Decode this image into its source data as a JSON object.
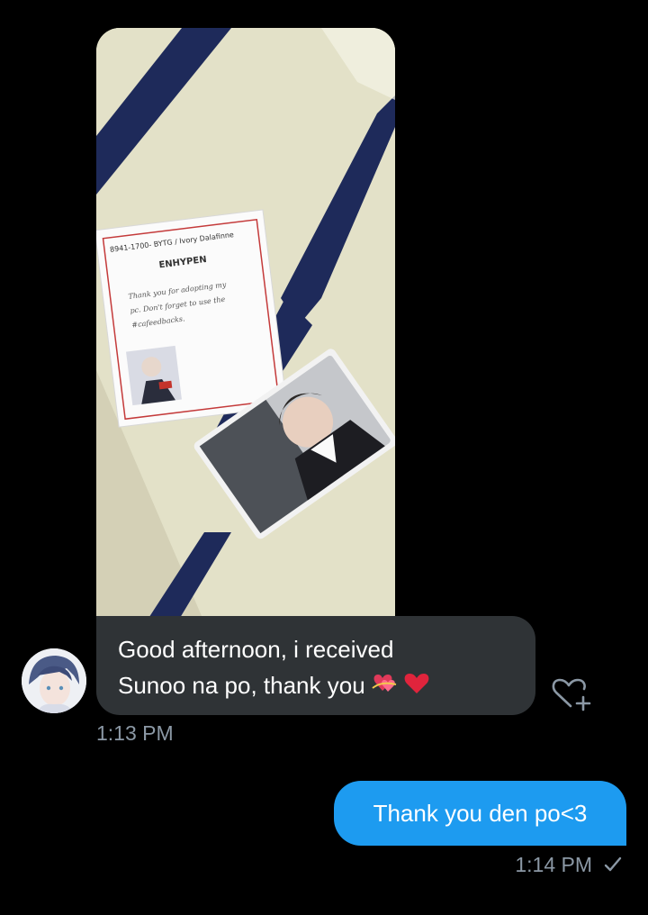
{
  "conversation": {
    "received_photo": {
      "card_label": "ENHYPEN",
      "card_header": "8941-1700- BYTG / Ivory Dalafinne",
      "card_note": [
        "Thank you for adopting my",
        "pc. Don't forget to use the",
        "#cafeedbacks."
      ]
    },
    "received_message": {
      "line1": "Good afternoon, i received",
      "line2": "Sunoo na po, thank you",
      "time": "1:13 PM"
    },
    "sent_message": {
      "text": "Thank you den po<3",
      "time": "1:14 PM"
    }
  },
  "colors": {
    "background": "#000000",
    "received_bubble": "#2f3336",
    "sent_bubble": "#1d9bf0",
    "timestamp": "#8b98a5"
  },
  "icons": {
    "like": "heart-plus-icon",
    "read_status": "checkmark-icon",
    "emoji": [
      "hearts-emoji",
      "red-heart-emoji"
    ]
  }
}
